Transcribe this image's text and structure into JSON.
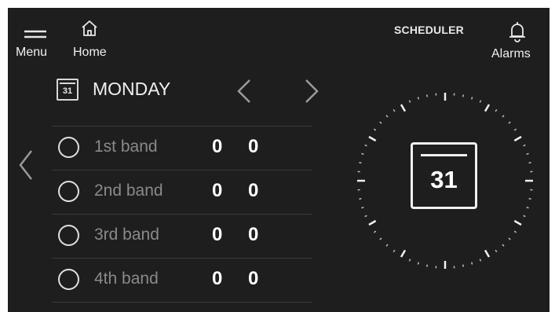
{
  "header": {
    "menu_label": "Menu",
    "home_label": "Home",
    "title": "SCHEDULER",
    "alarms_label": "Alarms"
  },
  "day_selector": {
    "day": "MONDAY",
    "calendar_number": "31"
  },
  "bands": [
    {
      "label": "1st band",
      "value1": "0",
      "value2": "0"
    },
    {
      "label": "2nd band",
      "value1": "0",
      "value2": "0"
    },
    {
      "label": "3rd band",
      "value1": "0",
      "value2": "0"
    },
    {
      "label": "4th band",
      "value1": "0",
      "value2": "0"
    }
  ],
  "dial": {
    "calendar_number": "31"
  },
  "icons": [
    "menu-icon",
    "home-icon",
    "bell-icon",
    "calendar-icon",
    "chevron-left-icon",
    "chevron-right-icon"
  ],
  "colors": {
    "background": "#1e1e1e",
    "text": "#e8e8e8",
    "muted": "#8a8a8a"
  }
}
